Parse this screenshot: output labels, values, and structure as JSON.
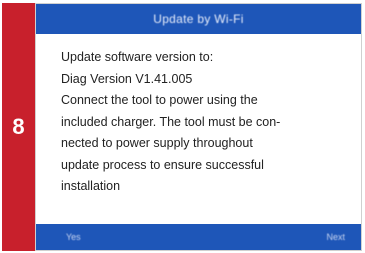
{
  "step": {
    "number": "8"
  },
  "dialog": {
    "title": "Update by Wi-Fi",
    "lines": [
      "Update software version to:",
      "Diag Version V1.41.005",
      "Connect the tool to power using the",
      "included charger. The tool must be con-",
      "nected to power supply throughout",
      "update process to ensure successful",
      "installation"
    ]
  },
  "buttons": {
    "left_label": "Yes",
    "right_label": "Next"
  },
  "colors": {
    "step_band": "#c8202c",
    "title_bar": "#1e56b8",
    "bottom_bar": "#1e56b8"
  }
}
